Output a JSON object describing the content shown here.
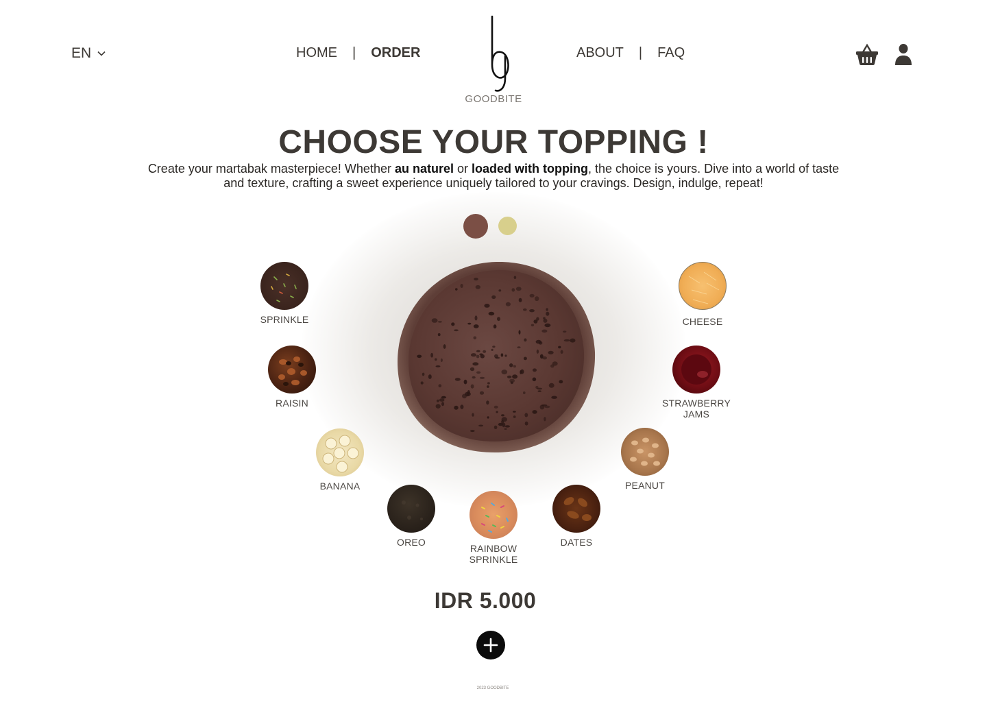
{
  "header": {
    "language": "EN",
    "nav_left": [
      {
        "label": "HOME",
        "active": false
      },
      {
        "label": "ORDER",
        "active": true
      }
    ],
    "nav_right": [
      {
        "label": "ABOUT",
        "active": false
      },
      {
        "label": "FAQ",
        "active": false
      }
    ],
    "separator": "|",
    "logo_text": "GOODBITE",
    "icons": [
      "chevron-down-icon",
      "basket-icon",
      "user-icon"
    ]
  },
  "main": {
    "title": "CHOOSE YOUR TOPPING !",
    "subtitle_parts": [
      "Create your martabak masterpiece! Whether ",
      "au naturel",
      " or ",
      "loaded with topping",
      ", the choice is yours. Dive into a world of taste and texture, crafting a sweet experience uniquely tailored to your cravings. Design, indulge, repeat!"
    ],
    "base_options": [
      {
        "name": "chocolate",
        "color": "#7b4f45",
        "selected": true
      },
      {
        "name": "vanilla",
        "color": "#d8cf8c",
        "selected": false
      }
    ],
    "toppings": [
      {
        "label": "SPRINKLE"
      },
      {
        "label": "RAISIN"
      },
      {
        "label": "BANANA"
      },
      {
        "label": "OREO"
      },
      {
        "label": "RAINBOW\nSPRINKLE"
      },
      {
        "label": "DATES"
      },
      {
        "label": "PEANUT"
      },
      {
        "label": "STRAWBERRY\nJAMS"
      },
      {
        "label": "CHEESE"
      }
    ],
    "price": "IDR 5.000"
  },
  "footer": {
    "copyright": "2023 GOODBITE"
  },
  "colors": {
    "text_dark": "#3d3935",
    "add_button": "#0b0b0b"
  }
}
